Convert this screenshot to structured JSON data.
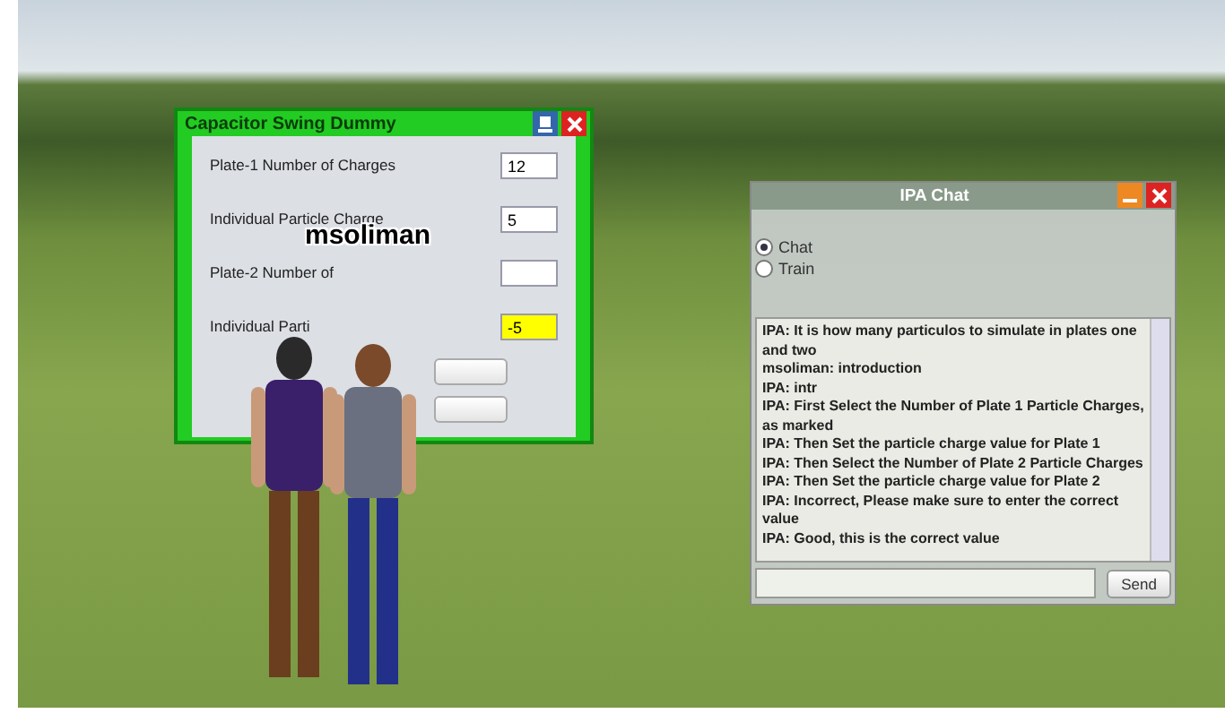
{
  "dialog": {
    "title": "Capacitor Swing Dummy",
    "fields": [
      {
        "label": "Plate-1 Number of Charges",
        "value": "12",
        "highlighted": false
      },
      {
        "label": "Individual Particle Charge",
        "value": "5",
        "highlighted": false
      },
      {
        "label": "Plate-2 Number of",
        "highlighted": false
      },
      {
        "label": "Individual Parti",
        "value": "-5",
        "highlighted": true
      }
    ]
  },
  "avatar_name": "msoliman",
  "chat": {
    "title": "IPA Chat",
    "modes": [
      {
        "label": "Chat",
        "selected": true
      },
      {
        "label": "Train",
        "selected": false
      }
    ],
    "messages": [
      "IPA: It is how many particulos to simulate in plates one and two",
      "msoliman: introduction",
      "IPA: intr",
      "IPA: First Select the Number of Plate 1 Particle Charges, as marked",
      "IPA: Then Set the particle charge value for Plate 1",
      "IPA: Then Select the Number of Plate 2 Particle Charges",
      "IPA: Then  Set the particle charge value for Plate 2",
      "IPA: Incorrect, Please make sure to enter the correct value",
      "IPA: Good, this is the correct value"
    ],
    "send": "Send"
  }
}
